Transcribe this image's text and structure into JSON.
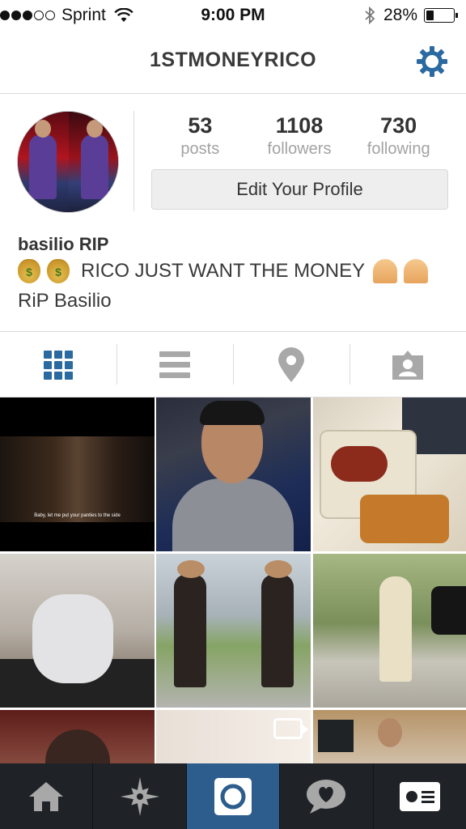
{
  "status_bar": {
    "carrier": "Sprint",
    "time": "9:00 PM",
    "battery": "28%",
    "battery_level": 0.28,
    "signal_bars_filled": 3,
    "signal_bars_total": 5
  },
  "header": {
    "title": "1STMONEYRICO",
    "settings_icon": "gear-icon",
    "accent_color": "#2b6aa0"
  },
  "profile": {
    "stats": [
      {
        "value": "53",
        "label": "posts"
      },
      {
        "value": "1108",
        "label": "followers"
      },
      {
        "value": "730",
        "label": "following"
      }
    ],
    "edit_button": "Edit Your Profile",
    "name": "basilio RIP",
    "bio_text": "RICO JUST WANT THE MONEY",
    "bio_emoji_left": [
      "money-bag-emoji",
      "money-bag-emoji"
    ],
    "bio_emoji_right": [
      "praying-hands-emoji",
      "praying-hands-emoji"
    ],
    "bio_line2": "RiP Basilio"
  },
  "view_tabs": [
    {
      "name": "grid-view-icon",
      "active": true
    },
    {
      "name": "list-view-icon",
      "active": false
    },
    {
      "name": "location-pin-icon",
      "active": false
    },
    {
      "name": "tagged-photos-icon",
      "active": false
    }
  ],
  "grid": {
    "caption": "Baby, let me put your panties to the side",
    "video_icon": "video-camera-icon"
  },
  "bottom_nav": [
    {
      "name": "home-icon",
      "active": false
    },
    {
      "name": "explore-icon",
      "active": false
    },
    {
      "name": "camera-icon",
      "active": true
    },
    {
      "name": "activity-icon",
      "active": false
    },
    {
      "name": "profile-icon",
      "active": false
    }
  ],
  "colors": {
    "active_tab": "#2c5d8d",
    "bottom_bar": "#1f2226",
    "icon_blue": "#2b6aa0",
    "icon_gray": "#a8a8a8"
  }
}
